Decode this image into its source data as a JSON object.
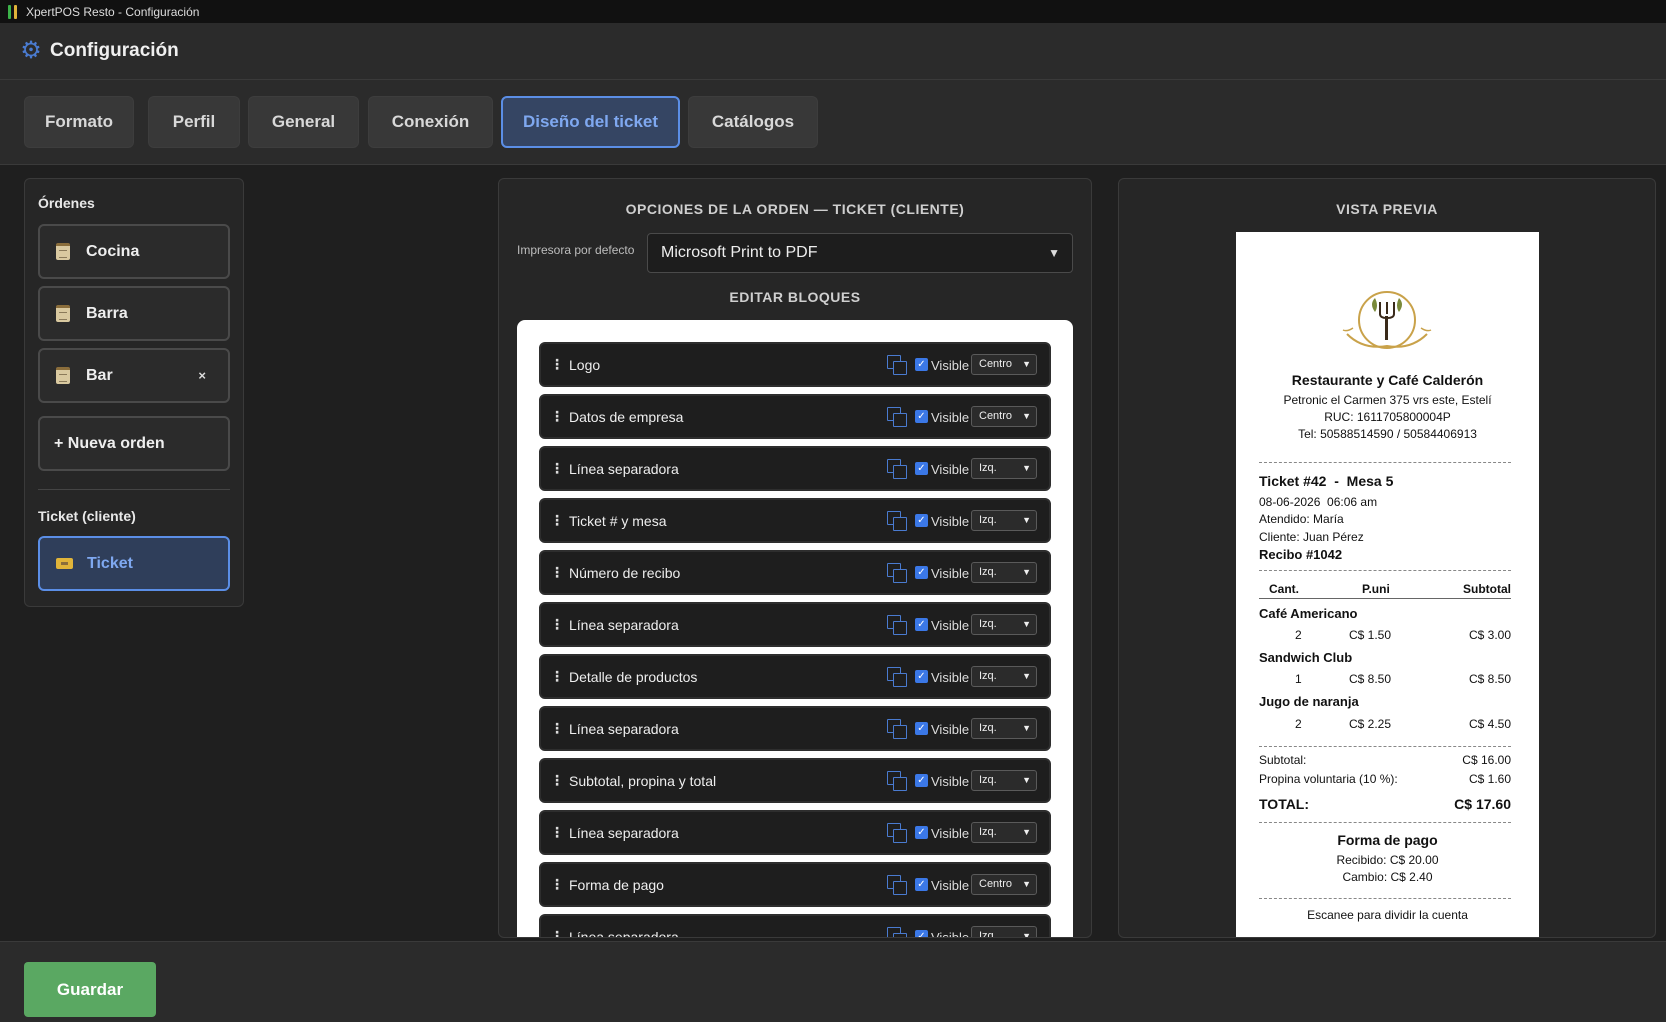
{
  "window": {
    "title": "XpertPOS Resto - Configuración"
  },
  "header": {
    "title": "Configuración"
  },
  "tabs": [
    {
      "label": "Formato"
    },
    {
      "label": "Perfil"
    },
    {
      "label": "General"
    },
    {
      "label": "Conexión"
    },
    {
      "label": "Diseño del ticket",
      "active": true
    },
    {
      "label": "Catálogos"
    }
  ],
  "sidebar": {
    "orders_label": "Órdenes",
    "orders": [
      "Cocina",
      "Barra",
      "Bar"
    ],
    "bar_close": "×",
    "new_order": "+ Nueva orden",
    "ticket_label": "Ticket (cliente)",
    "ticket_item": "Ticket"
  },
  "options": {
    "title": "OPCIONES DE LA ORDEN — TICKET (CLIENTE)",
    "printer_label": "Impresora por defecto",
    "printer_value": "Microsoft Print to PDF",
    "edit_blocks_title": "EDITAR BLOQUES",
    "visible_label": "Visible",
    "blocks": [
      {
        "name": "Logo",
        "align": "Centro"
      },
      {
        "name": "Datos de empresa",
        "align": "Centro"
      },
      {
        "name": "Línea separadora",
        "align": "Izq."
      },
      {
        "name": "Ticket # y mesa",
        "align": "Izq."
      },
      {
        "name": "Número de recibo",
        "align": "Izq."
      },
      {
        "name": "Línea separadora",
        "align": "Izq."
      },
      {
        "name": "Detalle de productos",
        "align": "Izq."
      },
      {
        "name": "Línea separadora",
        "align": "Izq."
      },
      {
        "name": "Subtotal, propina y total",
        "align": "Izq."
      },
      {
        "name": "Línea separadora",
        "align": "Izq."
      },
      {
        "name": "Forma de pago",
        "align": "Centro"
      },
      {
        "name": "Línea separadora",
        "align": "Izq."
      }
    ]
  },
  "preview": {
    "title": "VISTA PREVIA",
    "company_name": "Restaurante y Café Calderón",
    "address": "Petronic el Carmen 375 vrs este, Estelí",
    "ruc": "RUC: 1611705800004P",
    "phone": "Tel: 50588514590 / 50584406913",
    "ticket_line": "Ticket #42  -  Mesa 5",
    "datetime": "08-06-2026  06:06 am",
    "attended": "Atendido: María",
    "client": "Cliente: Juan Pérez",
    "receipt_no": "Recibo #1042",
    "col_qty": "Cant.",
    "col_unit": "P.uni",
    "col_subtotal": "Subtotal",
    "items": [
      {
        "name": "Café Americano",
        "qty": "2",
        "unit": "C$ 1.50",
        "subtotal": "C$ 3.00"
      },
      {
        "name": "Sandwich Club",
        "qty": "1",
        "unit": "C$ 8.50",
        "subtotal": "C$ 8.50"
      },
      {
        "name": "Jugo de naranja",
        "qty": "2",
        "unit": "C$ 2.25",
        "subtotal": "C$ 4.50"
      }
    ],
    "subtotal_label": "Subtotal:",
    "subtotal_value": "C$ 16.00",
    "tip_label": "Propina voluntaria (10 %):",
    "tip_value": "C$ 1.60",
    "total_label": "TOTAL:",
    "total_value": "C$ 17.60",
    "payment_title": "Forma de pago",
    "received": "Recibido: C$ 20.00",
    "change": "Cambio: C$ 2.40",
    "split_note": "Escanee para dividir la cuenta"
  },
  "footer": {
    "save_label": "Guardar"
  },
  "colors": {
    "accent": "#5b8ee6",
    "save": "#5aa862",
    "bg": "#1f1f1f",
    "panel": "#262626"
  }
}
